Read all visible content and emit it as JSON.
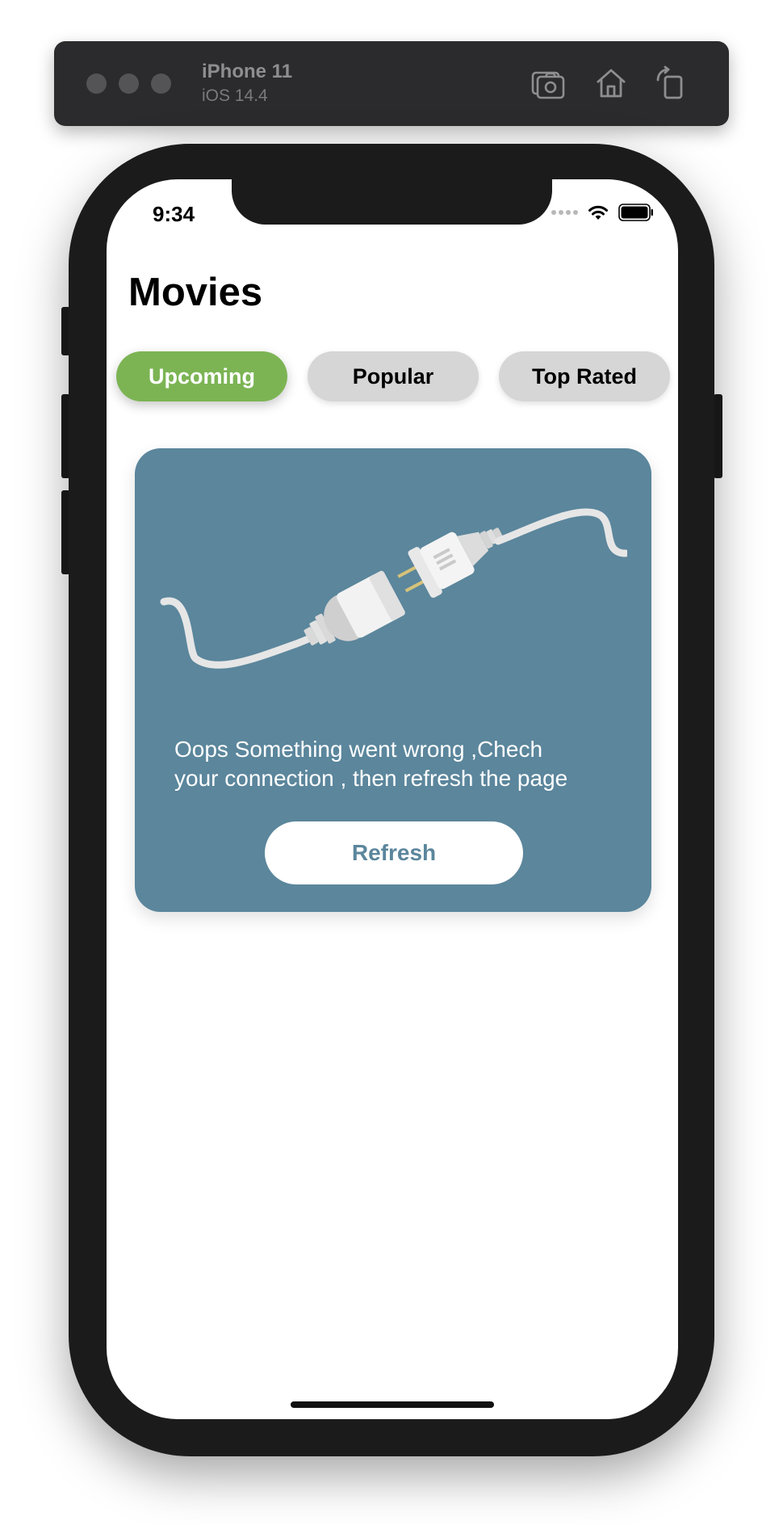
{
  "simulator": {
    "device_name": "iPhone 11",
    "os_version": "iOS 14.4",
    "icons": [
      "screenshot-icon",
      "home-icon",
      "rotate-icon"
    ]
  },
  "status_bar": {
    "time": "9:34",
    "icons": [
      "cellular-icon",
      "wifi-icon",
      "battery-icon"
    ]
  },
  "app": {
    "title": "Movies",
    "tabs": [
      {
        "label": "Upcoming",
        "active": true
      },
      {
        "label": "Popular",
        "active": false
      },
      {
        "label": "Top Rated",
        "active": false
      }
    ],
    "error_card": {
      "illustration": "unplugged-cable-icon",
      "message_line1": "Oops Something went wrong ,Chech",
      "message_line2": "your connection , then refresh the page",
      "button_label": "Refresh"
    }
  },
  "colors": {
    "accent_active_tab": "#7cb454",
    "inactive_tab": "#d6d6d6",
    "card_background": "#5b869c",
    "button_text": "#5b869c"
  }
}
